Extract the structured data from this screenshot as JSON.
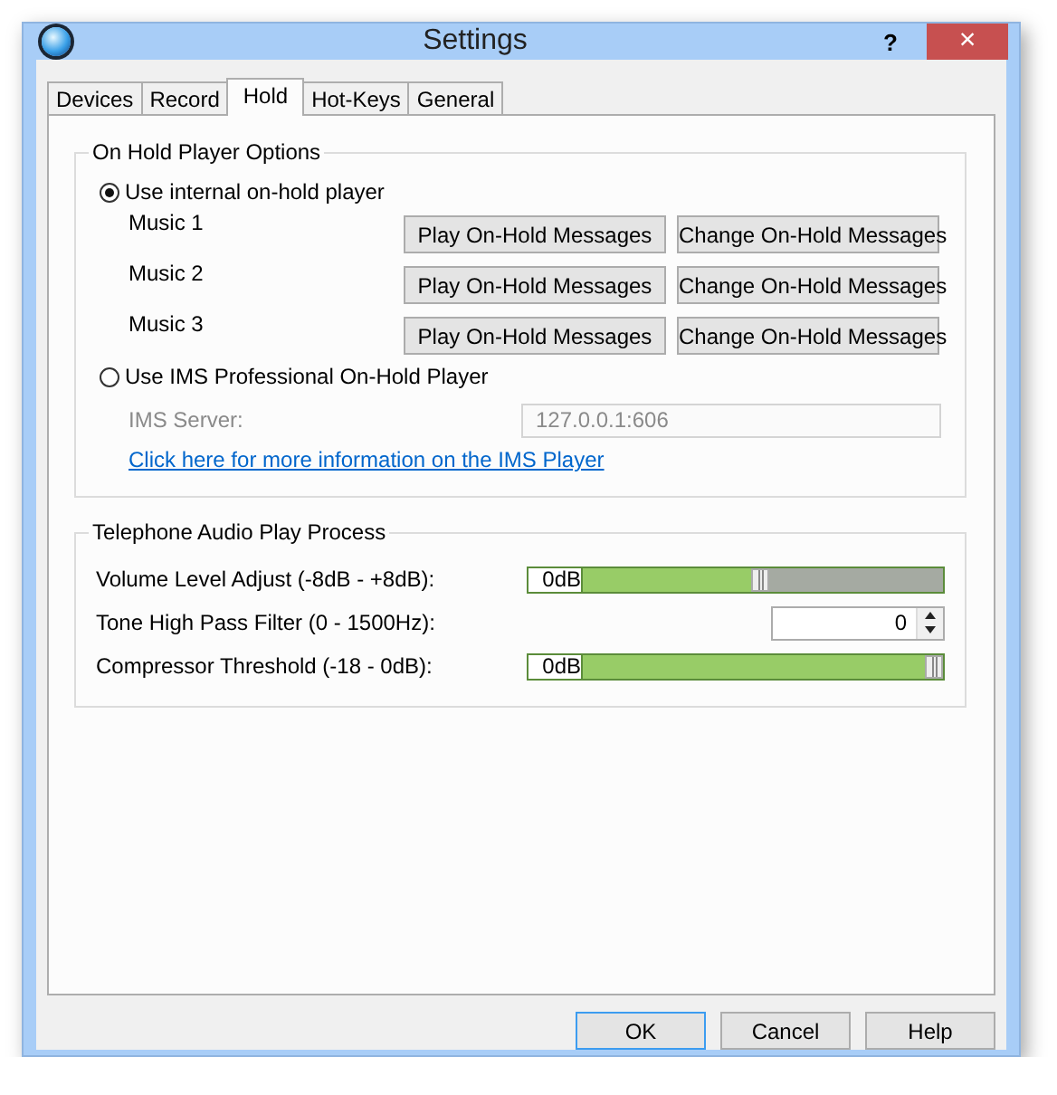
{
  "window": {
    "title": "Settings",
    "help": "?",
    "close": "×"
  },
  "tabs": [
    {
      "label": "Devices",
      "selected": false
    },
    {
      "label": "Record",
      "selected": false
    },
    {
      "label": "Hold",
      "selected": true
    },
    {
      "label": "Hot-Keys",
      "selected": false
    },
    {
      "label": "General",
      "selected": false
    }
  ],
  "on_hold_group": {
    "title": "On Hold Player Options",
    "options": [
      {
        "label": "Use internal on-hold player",
        "selected": true
      },
      {
        "label": "Use IMS Professional On-Hold Player",
        "selected": false
      }
    ],
    "music": [
      {
        "label": "Music 1",
        "play": "Play On-Hold Messages",
        "change": "Change On-Hold Messages"
      },
      {
        "label": "Music 2",
        "play": "Play On-Hold Messages",
        "change": "Change On-Hold Messages"
      },
      {
        "label": "Music 3",
        "play": "Play On-Hold Messages",
        "change": "Change On-Hold Messages"
      }
    ],
    "ims_server": {
      "label": "IMS Server:",
      "value": "127.0.0.1:606",
      "disabled": true
    },
    "link": "Click here for more information on the IMS Player"
  },
  "audio_group": {
    "title": "Telephone Audio Play Process",
    "rows": [
      {
        "kind": "slider",
        "label": "Volume Level Adjust (-8dB - +8dB):",
        "reading": "0dB",
        "level": 0.49
      },
      {
        "kind": "spinner",
        "label": "Tone High Pass Filter (0 - 1500Hz):",
        "value": "0"
      },
      {
        "kind": "slider",
        "label": "Compressor Threshold (-18 - 0dB):",
        "reading": "0dB",
        "level": 1
      }
    ]
  },
  "buttons": [
    {
      "label": "OK",
      "default": true
    },
    {
      "label": "Cancel",
      "default": false
    },
    {
      "label": "Help",
      "default": false
    }
  ]
}
